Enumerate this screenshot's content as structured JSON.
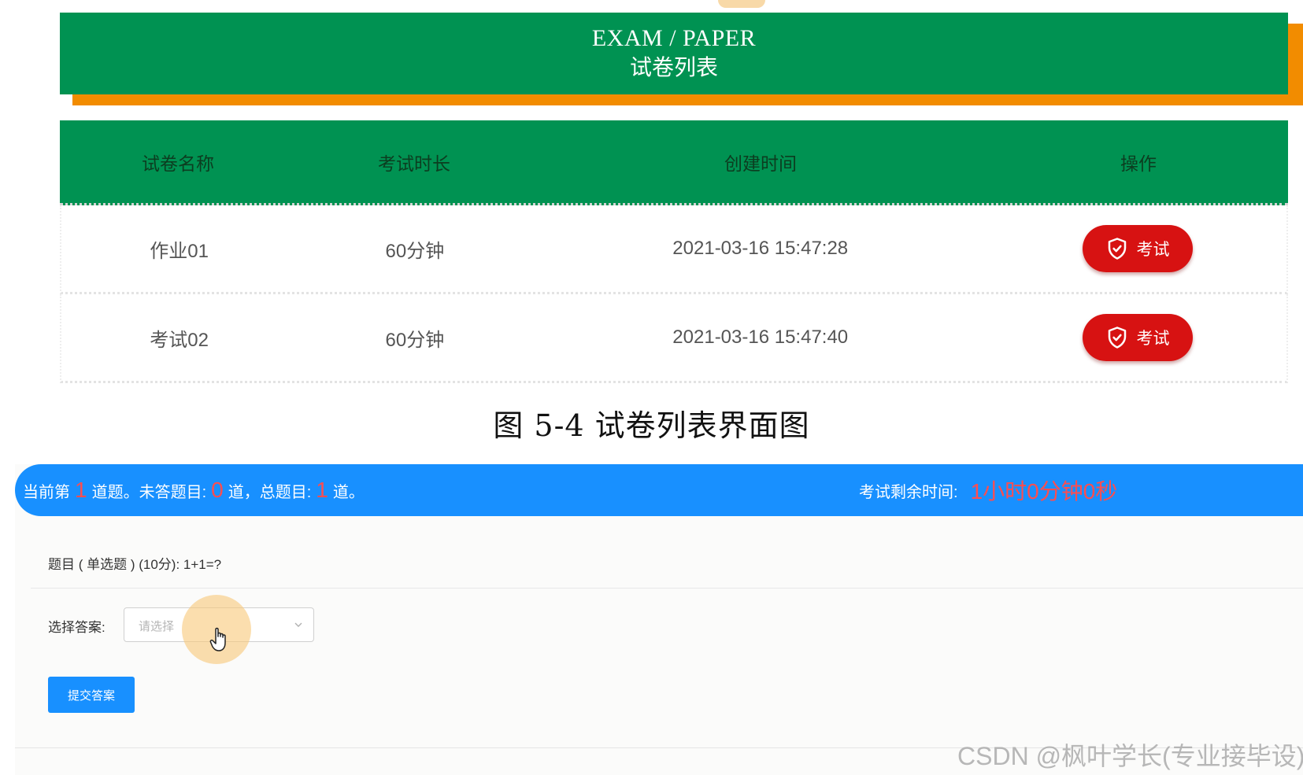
{
  "exam_list": {
    "header_en": "EXAM / PAPER",
    "header_cn": "试卷列表",
    "columns": [
      "试卷名称",
      "考试时长",
      "创建时间",
      "操作"
    ],
    "rows": [
      {
        "name": "作业01",
        "duration": "60分钟",
        "created": "2021-03-16 15:47:28",
        "action": "考试"
      },
      {
        "name": "考试02",
        "duration": "60分钟",
        "created": "2021-03-16 15:47:40",
        "action": "考试"
      }
    ],
    "accent_green": "#009252",
    "accent_orange": "#f28c00",
    "button_red": "#d71212"
  },
  "caption": "图 5-4  试卷列表界面图",
  "exam": {
    "status": {
      "current_prefix": "当前第",
      "current_num": "1",
      "unanswered_prefix": "道题。未答题目:",
      "unanswered_num": "0",
      "total_prefix": "道，总题目:",
      "total_num": "1",
      "total_suffix": "道。",
      "time_label": "考试剩余时间:",
      "time_value": "1小时0分钟0秒",
      "bar_color": "#1890ff"
    },
    "question": "题目 ( 单选题 ) (10分):   1+1=?",
    "answer_label": "选择答案:",
    "select_placeholder": "请选择",
    "submit_label": "提交答案",
    "icons": [
      "shield-check-icon",
      "chevron-down-icon",
      "hand-pointer-icon"
    ]
  },
  "watermark": "CSDN @枫叶学长(专业接毕设)"
}
